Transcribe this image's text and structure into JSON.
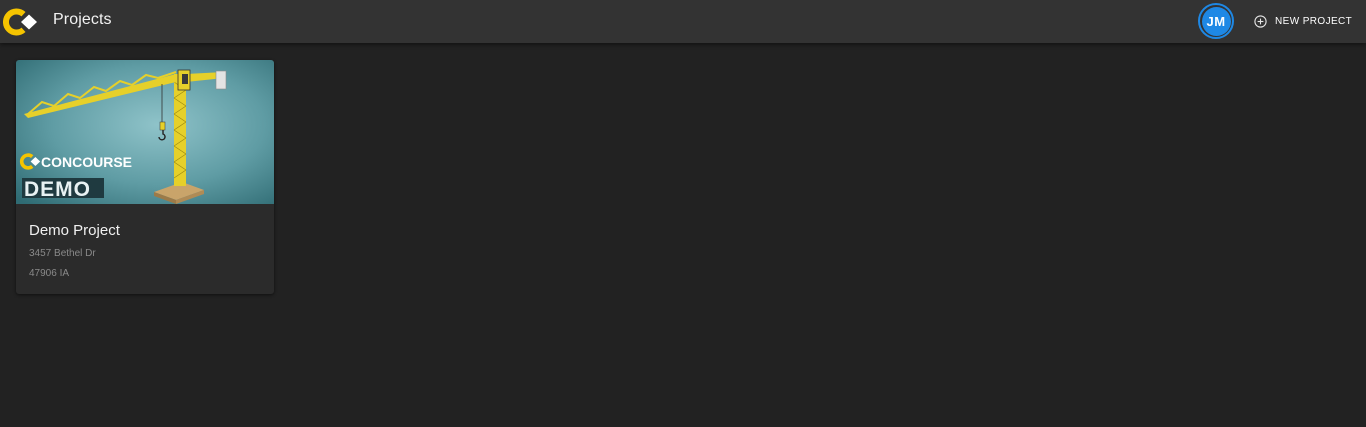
{
  "app_bar": {
    "title": "Projects",
    "logo_icon": "concourse-logo-icon",
    "avatar_initials": "JM",
    "new_project_label": "NEW PROJECT",
    "new_project_icon": "plus-circle-icon"
  },
  "projects": [
    {
      "name": "Demo Project",
      "address": "3457 Bethel Dr",
      "zip_state": "47906 IA",
      "thumbnail": {
        "brand_text": "CONCOURSE",
        "badge_text": "DEMO",
        "image_icon": "tower-crane-image"
      }
    }
  ],
  "colors": {
    "background": "#222222",
    "app_bar": "#333333",
    "brand_yellow": "#f5c400",
    "avatar_blue": "#1e88e5",
    "card": "#2b2b2b"
  }
}
